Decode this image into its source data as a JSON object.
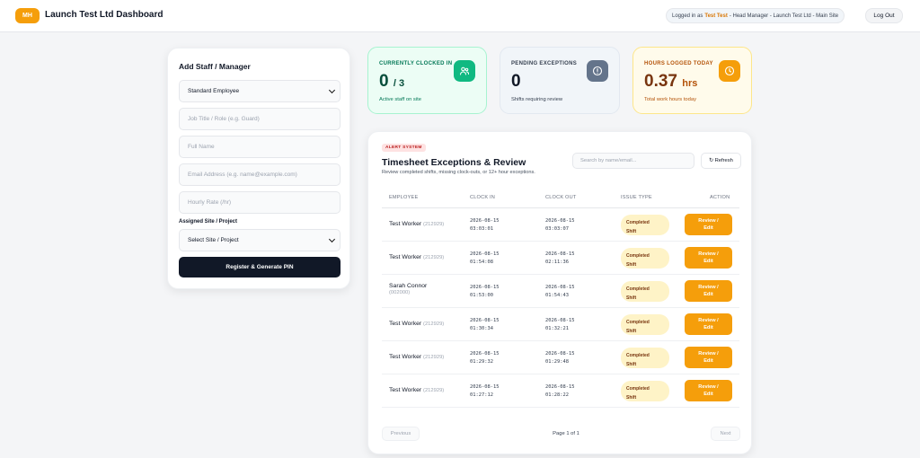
{
  "header": {
    "logo_text": "MH",
    "title": "Launch Test Ltd Dashboard",
    "login_prefix": "Logged in as",
    "login_user": "Test Test",
    "login_suffix": "- Head Manager - Launch Test Ltd - Main Site",
    "logout_label": "Log Out"
  },
  "add_staff": {
    "title": "Add Staff / Manager",
    "role_select": "Standard Employee",
    "job_title_placeholder": "Job Title / Role (e.g. Guard)",
    "full_name_placeholder": "Full Name",
    "email_placeholder": "Email Address (e.g. name@example.com)",
    "rate_placeholder": "Hourly Rate (/hr)",
    "site_label": "Assigned Site / Project",
    "site_select": "Select Site / Project",
    "register_label": "Register & Generate PIN"
  },
  "stats": {
    "clocked_in": {
      "label": "CURRENTLY CLOCKED IN",
      "value": "0",
      "total": "/ 3",
      "sub": "Active staff on site",
      "icon": "users-icon"
    },
    "exceptions": {
      "label": "PENDING EXCEPTIONS",
      "value": "0",
      "sub": "Shifts requiring review",
      "icon": "alert-icon"
    },
    "hours": {
      "label": "HOURS LOGGED TODAY",
      "value": "0.37",
      "unit": "hrs",
      "sub": "Total work hours today",
      "icon": "clock-icon"
    }
  },
  "timesheet": {
    "badge": "ALERT SYSTEM",
    "title": "Timesheet Exceptions & Review",
    "subtitle": "Review completed shifts, missing clock-outs, or 12+ hour exceptions.",
    "search_placeholder": "Search by name/email...",
    "refresh_label": "↻ Refresh",
    "columns": [
      "EMPLOYEE",
      "CLOCK IN",
      "CLOCK OUT",
      "ISSUE TYPE",
      "ACTION"
    ],
    "rows": [
      {
        "name": "Test Worker",
        "pin": "(212929)",
        "in_date": "2026-08-15",
        "in_time": "03:03:01",
        "out_date": "2026-08-15",
        "out_time": "03:03:07",
        "issue_1": "Completed",
        "issue_2": "Shift",
        "action_1": "Review /",
        "action_2": "Edit"
      },
      {
        "name": "Test Worker",
        "pin": "(212929)",
        "in_date": "2026-08-15",
        "in_time": "01:54:08",
        "out_date": "2026-08-15",
        "out_time": "02:11:36",
        "issue_1": "Completed",
        "issue_2": "Shift",
        "action_1": "Review /",
        "action_2": "Edit"
      },
      {
        "name": "Sarah Connor",
        "pin": "(002000)",
        "in_date": "2026-08-15",
        "in_time": "01:53:00",
        "out_date": "2026-08-15",
        "out_time": "01:54:43",
        "issue_1": "Completed",
        "issue_2": "Shift",
        "action_1": "Review /",
        "action_2": "Edit"
      },
      {
        "name": "Test Worker",
        "pin": "(212929)",
        "in_date": "2026-08-15",
        "in_time": "01:30:34",
        "out_date": "2026-08-15",
        "out_time": "01:32:21",
        "issue_1": "Completed",
        "issue_2": "Shift",
        "action_1": "Review /",
        "action_2": "Edit"
      },
      {
        "name": "Test Worker",
        "pin": "(212929)",
        "in_date": "2026-08-15",
        "in_time": "01:29:32",
        "out_date": "2026-08-15",
        "out_time": "01:29:48",
        "issue_1": "Completed",
        "issue_2": "Shift",
        "action_1": "Review /",
        "action_2": "Edit"
      },
      {
        "name": "Test Worker",
        "pin": "(212929)",
        "in_date": "2026-08-15",
        "in_time": "01:27:12",
        "out_date": "2026-08-15",
        "out_time": "01:28:22",
        "issue_1": "Completed",
        "issue_2": "Shift",
        "action_1": "Review /",
        "action_2": "Edit"
      }
    ],
    "prev_label": "Previous",
    "page_info": "Page 1 of 1",
    "next_label": "Next"
  },
  "colors": {
    "accent": "#f59e0b",
    "green": "#10b981",
    "dark": "#111827"
  }
}
